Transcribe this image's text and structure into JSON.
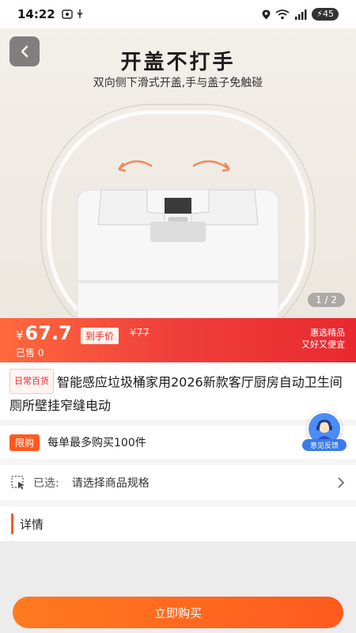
{
  "status_bar": {
    "time": "14:22",
    "battery": "45"
  },
  "hero": {
    "title": "开盖不打手",
    "subtitle": "双向侧下滑式开盖,手与盖子免触碰",
    "page_indicator": "1 / 2"
  },
  "price": {
    "currency": "¥",
    "value": "67.7",
    "final_label": "到手价",
    "original": "¥77",
    "sold": "已售 0",
    "promo_line1": "惠选精品",
    "promo_line2": "又好又便宜"
  },
  "product": {
    "category_tag": "日常百货",
    "title": "智能感应垃圾桶家用2026新款客厅厨房自动卫生间厕所壁挂窄缝电动"
  },
  "feedback": {
    "label": "意见反馈"
  },
  "limit": {
    "badge": "限购",
    "text": "每单最多购买100件"
  },
  "spec": {
    "label": "已选:",
    "value": "请选择商品规格"
  },
  "details": {
    "title": "详情"
  },
  "actions": {
    "buy_label": "立即购买"
  },
  "colors": {
    "accent": "#ff5a1f",
    "price_red": "#e8292f",
    "feedback_blue": "#4b8df5"
  }
}
